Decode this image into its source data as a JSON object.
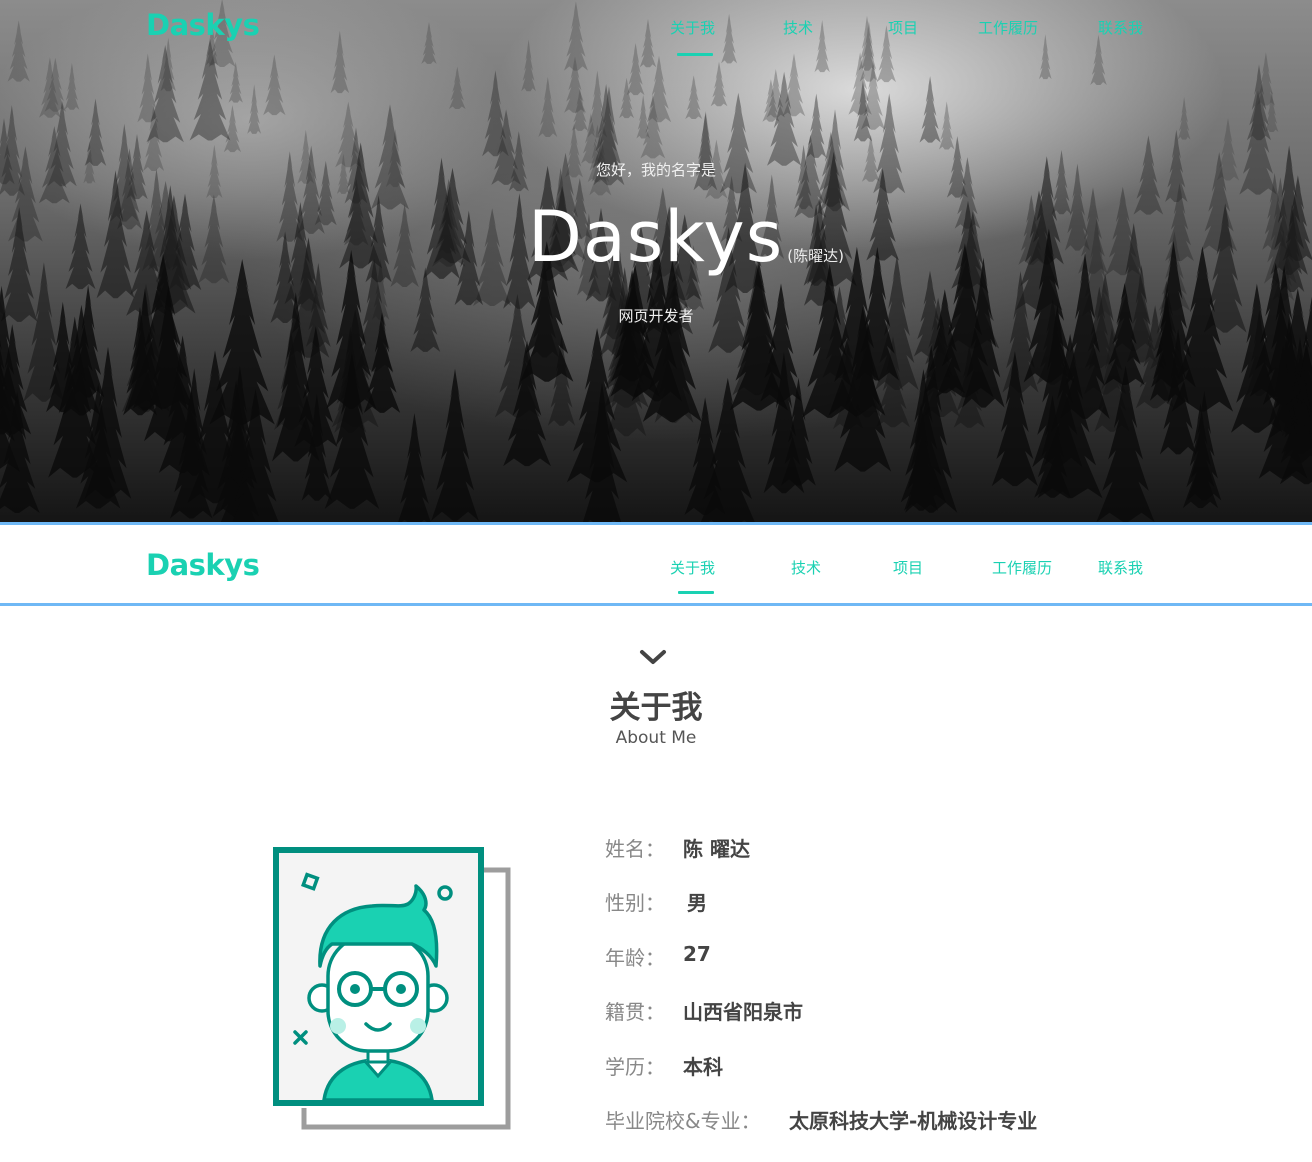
{
  "brand": {
    "logo_text": "Daskys",
    "accent_color": "#1ad1b2",
    "divider_color": "#6fb8f5"
  },
  "nav": {
    "items": [
      {
        "label": "关于我",
        "active": true
      },
      {
        "label": "技术",
        "active": false
      },
      {
        "label": "项目",
        "active": false
      },
      {
        "label": "工作履历",
        "active": false
      },
      {
        "label": "联系我",
        "active": false
      }
    ]
  },
  "hero": {
    "greeting": "您好，我的名字是",
    "name": "Daskys",
    "chinese_name": "(陈曜达)",
    "role": "网页开发者"
  },
  "about": {
    "title": "关于我",
    "subtitle": "About Me",
    "chevron_icon": "chevron-down-icon",
    "avatar_icon": "developer-avatar-illustration",
    "fields": [
      {
        "label": "姓名：",
        "value": "陈 曜达"
      },
      {
        "label": "性别：",
        "value": "男"
      },
      {
        "label": "年龄：",
        "value": "27"
      },
      {
        "label": "籍贯：",
        "value": "山西省阳泉市"
      },
      {
        "label": "学历：",
        "value": "本科"
      },
      {
        "label": "毕业院校&专业：",
        "value": "太原科技大学-机械设计专业"
      }
    ]
  }
}
